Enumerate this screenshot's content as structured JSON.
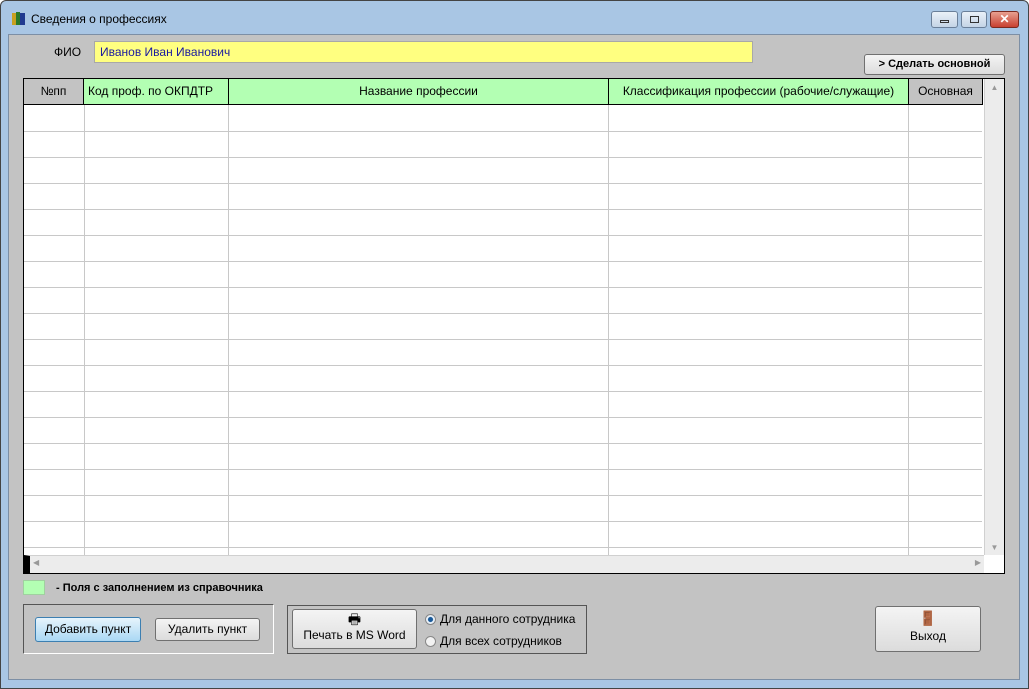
{
  "window": {
    "title": "Сведения о профессиях"
  },
  "form": {
    "fio_label": "ФИО",
    "fio_value": "Иванов Иван Иванович",
    "make_main_button": "> Сделать основной"
  },
  "table": {
    "columns": [
      "№пп",
      "Код проф. по ОКПДТР",
      "Название профессии",
      "Классификация профессии (рабочие/служащие)",
      "Основная"
    ],
    "rows": []
  },
  "legend": {
    "text": "-  Поля с заполнением из справочника",
    "color": "#b3ffb3"
  },
  "buttons": {
    "add": "Добавить пункт",
    "delete": "Удалить пункт",
    "print": "Печать в MS Word",
    "exit": "Выход"
  },
  "print_options": [
    "Для данного сотрудника",
    "Для всех сотрудников"
  ],
  "colors": {
    "fio_bg": "#ffff80",
    "header_green": "#b3ffb3",
    "body": "#c3c3c3"
  }
}
